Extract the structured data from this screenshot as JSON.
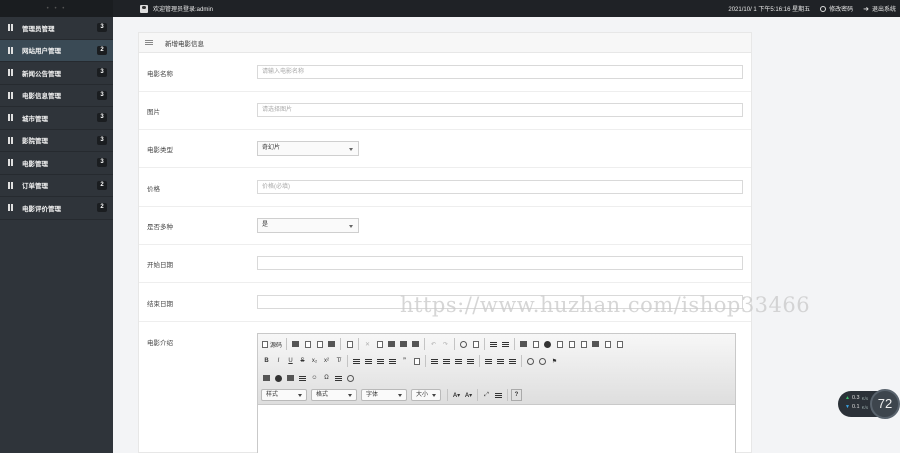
{
  "topbar": {
    "logo_dots": "• • •",
    "user_text": "欢迎管理员登录:admin",
    "datetime": "2021/10/ 1 下午5:16:16 星期五",
    "change_pwd": "修改密码",
    "logout": "退出系统"
  },
  "sidebar": {
    "items": [
      {
        "label": "管理员管理",
        "badge": "3"
      },
      {
        "label": "网站用户管理",
        "badge": "2"
      },
      {
        "label": "新闻公告管理",
        "badge": "3"
      },
      {
        "label": "电影信息管理",
        "badge": "3"
      },
      {
        "label": "城市管理",
        "badge": "3"
      },
      {
        "label": "影院管理",
        "badge": "3"
      },
      {
        "label": "电影管理",
        "badge": "3"
      },
      {
        "label": "订单管理",
        "badge": "2"
      },
      {
        "label": "电影评价管理",
        "badge": "2"
      }
    ]
  },
  "panel": {
    "title": "新增电影信息",
    "fields": {
      "name": {
        "label": "电影名称",
        "placeholder": "请输入电影名称"
      },
      "image": {
        "label": "图片",
        "placeholder": "请选择图片"
      },
      "type": {
        "label": "电影类型",
        "value": "奇幻片"
      },
      "price": {
        "label": "价格",
        "placeholder": "价格(必填)"
      },
      "multi": {
        "label": "是否多种",
        "value": "是"
      },
      "start_date": {
        "label": "开始日期",
        "placeholder": ""
      },
      "end_date": {
        "label": "结束日期",
        "placeholder": ""
      },
      "intro": {
        "label": "电影介绍"
      }
    }
  },
  "editor": {
    "source_label": "源码",
    "dropdowns": {
      "style": "样式",
      "format": "格式",
      "font": "字体",
      "size": "大小"
    },
    "help": "?"
  },
  "watermark": "https://www.huzhan.com/ishop33466",
  "speed": {
    "up": "0.3",
    "down": "0.1",
    "unit": "K/s",
    "percent": "72"
  }
}
